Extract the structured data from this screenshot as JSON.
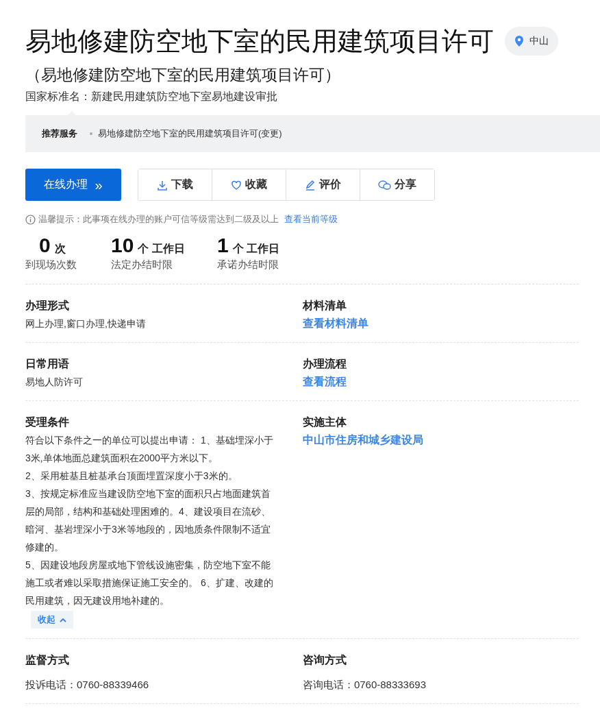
{
  "header": {
    "title": "易地修建防空地下室的民用建筑项目许可",
    "location": "中山",
    "subtitle": "（易地修建防空地下室的民用建筑项目许可）",
    "national_name": "国家标准名：新建民用建筑防空地下室易地建设审批"
  },
  "recommend": {
    "label": "推荐服务",
    "items": [
      "易地修建防空地下室的民用建筑项目许可(变更)"
    ]
  },
  "actions": {
    "primary": {
      "label": "在线办理",
      "arrow": "»"
    },
    "buttons": [
      {
        "kind": "download",
        "label": "下载"
      },
      {
        "kind": "favorite",
        "label": "收藏"
      },
      {
        "kind": "review",
        "label": "评价"
      },
      {
        "kind": "share",
        "label": "分享"
      }
    ]
  },
  "tip": {
    "text": "温馨提示：此事项在线办理的账户可信等级需达到二级及以上",
    "link": "查看当前等级"
  },
  "stats": [
    {
      "value": "0",
      "unit": "次",
      "label": "到现场次数"
    },
    {
      "value": "10",
      "unit": "个 工作日",
      "label": "法定办结时限"
    },
    {
      "value": "1",
      "unit": "个 工作日",
      "label": "承诺办结时限"
    }
  ],
  "sections": [
    [
      {
        "title": "办理形式",
        "kind": "text",
        "lines": [
          "网上办理,窗口办理,快递申请"
        ]
      },
      {
        "title": "材料清单",
        "kind": "link",
        "lines": [
          "查看材料清单"
        ]
      }
    ],
    [
      {
        "title": "日常用语",
        "kind": "text",
        "lines": [
          "易地人防许可"
        ]
      },
      {
        "title": "办理流程",
        "kind": "link",
        "lines": [
          "查看流程"
        ]
      }
    ],
    [
      {
        "title": "受理条件",
        "kind": "text",
        "lines": [
          "符合以下条件之一的单位可以提出申请： 1、基础埋深小于3米,单体地面总建筑面积在2000平方米以下。",
          "2、采用桩基且桩基承台顶面埋置深度小于3米的。",
          "3、按规定标准应当建设防空地下室的面积只占地面建筑首层的局部，结构和基础处理困难的。4、建设项目在流砂、暗河、基岩埋深小于3米等地段的，因地质条件限制不适宜修建的。",
          "5、因建设地段房屋或地下管线设施密集，防空地下室不能施工或者难以采取措施保证施工安全的。 6、扩建、改建的民用建筑，因无建设用地补建的。"
        ],
        "collapse": {
          "label": "收起",
          "expanded": true
        }
      },
      {
        "title": "实施主体",
        "kind": "link",
        "lines": [
          "中山市住房和城乡建设局"
        ]
      }
    ],
    [
      {
        "title": "监督方式",
        "kind": "contact",
        "lines": [
          "投诉电话：0760-88339466"
        ]
      },
      {
        "title": "咨询方式",
        "kind": "contact",
        "lines": [
          "咨询电话：0760-88333693"
        ]
      }
    ]
  ]
}
